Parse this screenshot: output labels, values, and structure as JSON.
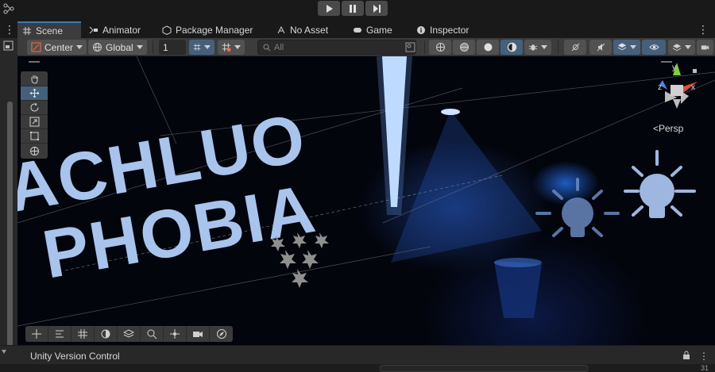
{
  "play_controls": {
    "play": "play-icon",
    "pause": "pause-icon",
    "step": "step-icon"
  },
  "tabs": [
    {
      "label": "Scene",
      "icon": "grid-icon"
    },
    {
      "label": "Animator",
      "icon": "animator-icon"
    },
    {
      "label": "Package Manager",
      "icon": "package-icon"
    },
    {
      "label": "No Asset",
      "icon": "asset-icon"
    },
    {
      "label": "Game",
      "icon": "gamepad-icon"
    },
    {
      "label": "Inspector",
      "icon": "info-icon"
    }
  ],
  "toolbar": {
    "pivot_label": "Center",
    "space_label": "Global",
    "grid_value": "1",
    "search_placeholder": "All"
  },
  "scene": {
    "persp_label": "<Persp",
    "gizmo_axes": {
      "y": "y",
      "x": "x",
      "z": "z"
    },
    "title_line1": "ACHLUO",
    "title_line2": "PHOBIA"
  },
  "bottom_panel": {
    "title": "Unity Version Control"
  },
  "status": {
    "count": "31"
  },
  "colors": {
    "accent": "#3a79bb",
    "selected": "#46607c",
    "light": "#4a7fd6"
  }
}
